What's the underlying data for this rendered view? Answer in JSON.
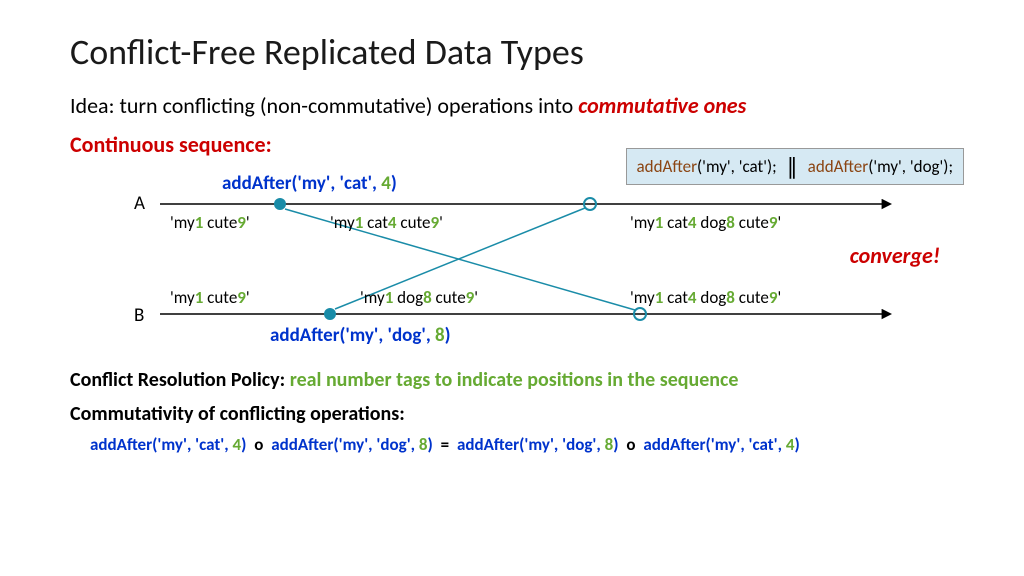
{
  "title": "Conflict-Free Replicated Data Types",
  "idea_prefix": "Idea: turn conflicting (non-commutative) operations into ",
  "idea_em": "commutative ones",
  "section": "Continuous sequence:",
  "codebox": {
    "fn1": "addAfter",
    "args1": "('my', 'cat'); ",
    "fn2": "addAfter",
    "args2": "('my', 'dog');"
  },
  "timelines": {
    "a": "A",
    "b": "B"
  },
  "op_a": {
    "fn": "addAfter(",
    "arg_open": "'my', 'cat', ",
    "tag": "4",
    "close": ")"
  },
  "op_b": {
    "fn": "addAfter(",
    "arg_open": "'my', 'dog', ",
    "tag": "8",
    "close": ")"
  },
  "states": {
    "a0": {
      "p1": "'my",
      "t1": "1",
      "p2": " cute",
      "t2": "9",
      "p3": "'"
    },
    "a1": {
      "p1": "'my",
      "t1": "1",
      "p2": " cat",
      "t2": "4",
      "p3": " cute",
      "t3": "9",
      "p4": "'"
    },
    "a2": {
      "p1": "'my",
      "t1": "1",
      "p2": " cat",
      "t2": "4",
      "p3": " dog",
      "t3": "8",
      "p4": " cute",
      "t4": "9",
      "p5": "'"
    },
    "b0": {
      "p1": "'my",
      "t1": "1",
      "p2": " cute",
      "t2": "9",
      "p3": "'"
    },
    "b1": {
      "p1": "'my",
      "t1": "1",
      "p2": " dog",
      "t2": "8",
      "p3": " cute",
      "t3": "9",
      "p4": "'"
    },
    "b2": {
      "p1": "'my",
      "t1": "1",
      "p2": " cat",
      "t2": "4",
      "p3": " dog",
      "t3": "8",
      "p4": " cute",
      "t4": "9",
      "p5": "'"
    }
  },
  "converge": "converge!",
  "policy": {
    "label": "Conflict Resolution Policy: ",
    "text": "real number tags to indicate positions in the sequence"
  },
  "commut_head": "Commutativity of conflicting operations:",
  "commut_line": {
    "a": {
      "fn": "addAfter('my', 'cat', ",
      "tag": "4",
      "close": ")"
    },
    "b": {
      "fn": "addAfter('my', 'dog', ",
      "tag": "8",
      "close": ")"
    },
    "o": "o",
    "eq": " = "
  }
}
